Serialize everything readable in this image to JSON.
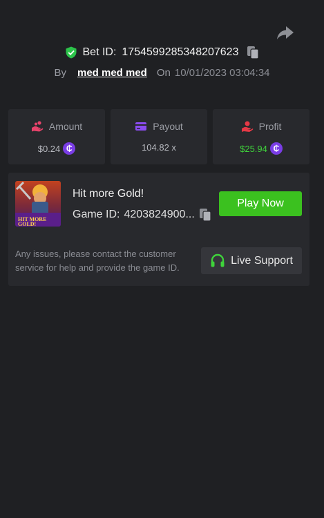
{
  "header": {
    "bet_id_label": "Bet ID:",
    "bet_id": "1754599285348207623",
    "by_label": "By",
    "username": "med med med",
    "on_label": "On",
    "date": "10/01/2023 03:04:34"
  },
  "stats": {
    "amount": {
      "label": "Amount",
      "value": "$0.24",
      "icon": "hand-coins-icon"
    },
    "payout": {
      "label": "Payout",
      "value": "104.82 x",
      "icon": "card-icon"
    },
    "profit": {
      "label": "Profit",
      "value": "$25.94",
      "icon": "hand-money-icon"
    }
  },
  "game": {
    "title": "Hit more Gold!",
    "id_label": "Game ID:",
    "id_value": "4203824900...",
    "thumb_text": "HIT MORE GOLD!",
    "play_label": "Play Now"
  },
  "support": {
    "text": "Any issues, please contact the customer service for help and provide the game ID.",
    "button_label": "Live Support"
  },
  "coin_symbol": "₵",
  "colors": {
    "background": "#1f2023",
    "card": "#28292d",
    "accent_green": "#3bc11f",
    "profit_green": "#3fd33b",
    "coin_purple": "#7a3de6"
  }
}
